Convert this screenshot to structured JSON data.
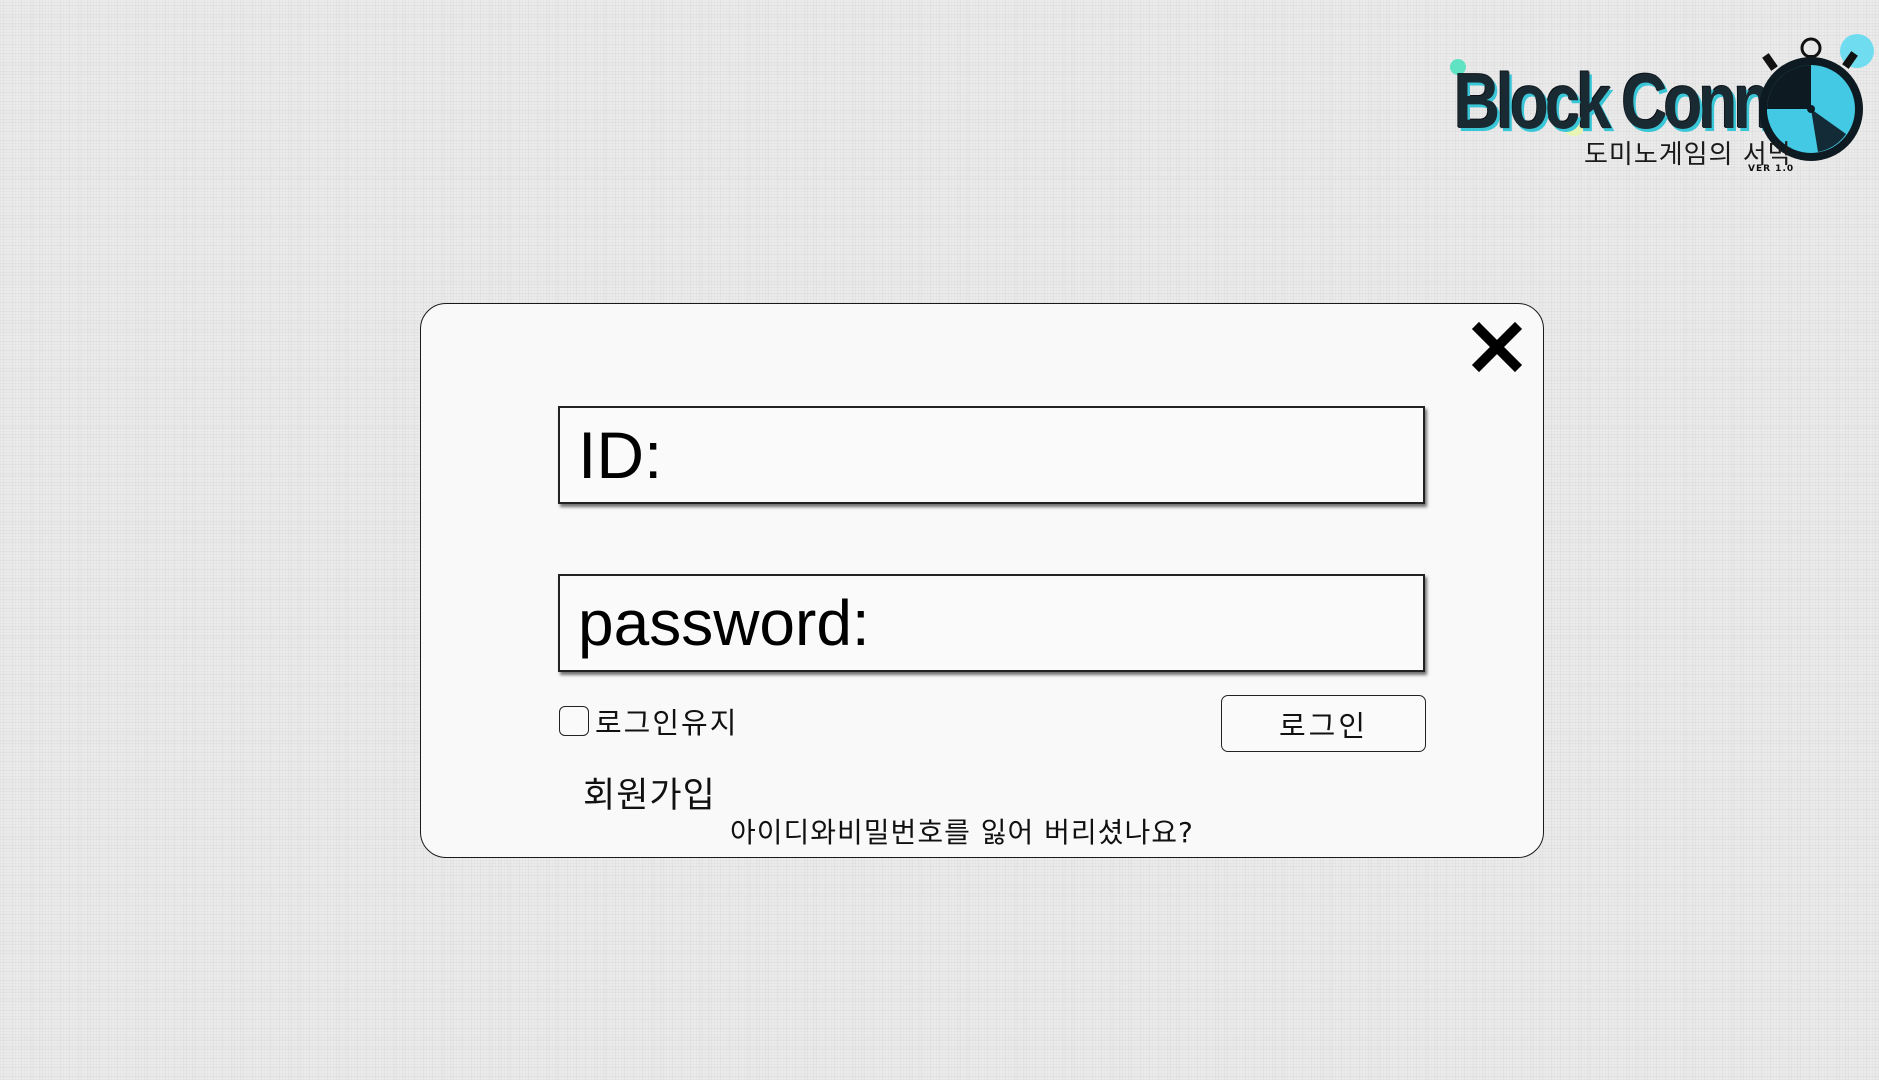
{
  "logo": {
    "title": "Block Connect",
    "subtitle": "도미노게임의 서막",
    "version": "VER 1.0",
    "icon": "stopwatch-icon",
    "colors": {
      "accent": "#39c6d7",
      "dark": "#1a2a33",
      "highlight": "#e9f8a8"
    }
  },
  "dialog": {
    "close_icon": "close-icon",
    "id_label": "ID:",
    "id_value": "",
    "password_label": "password:",
    "password_value": "",
    "remember_label": "로그인유지",
    "remember_checked": false,
    "login_label": "로그인",
    "signup_label": "회원가입",
    "forgot_label": "아이디와비밀번호를 잃어 버리셨나요?"
  },
  "colors": {
    "background": "#ececec",
    "dialog_background": "#f9f9f9",
    "border": "#1a1a1a"
  }
}
